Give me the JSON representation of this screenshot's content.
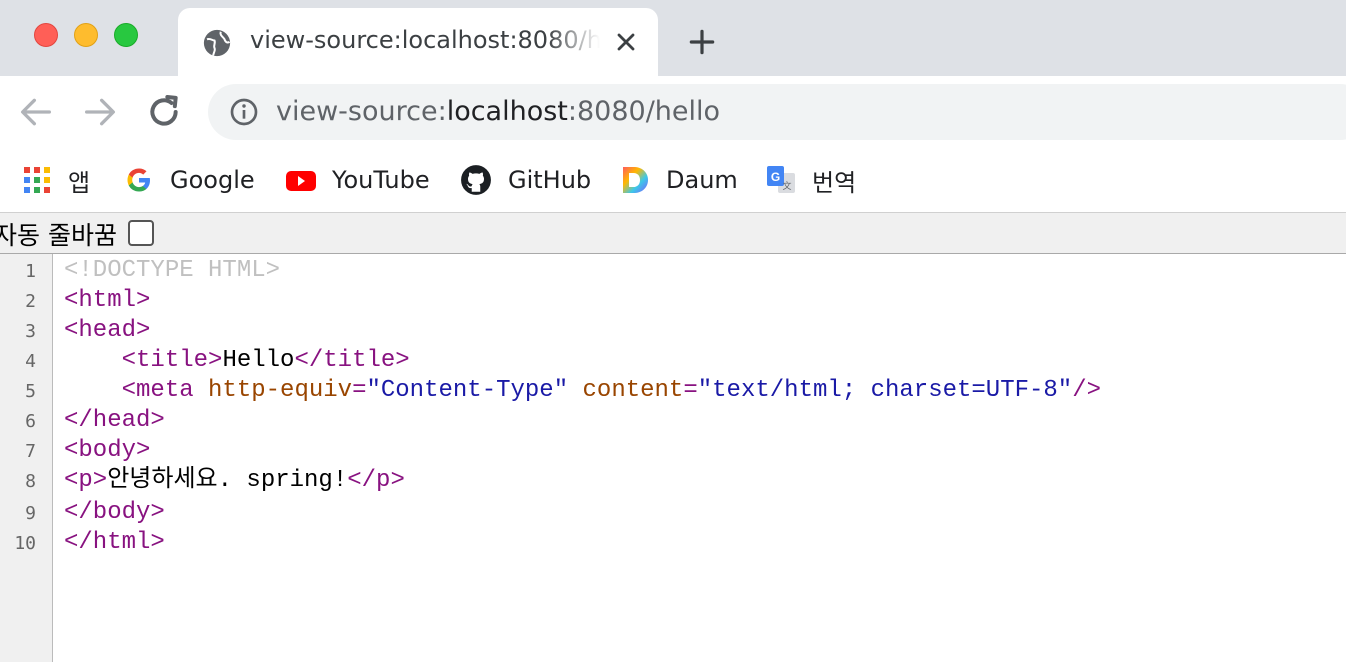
{
  "tab": {
    "title": "view-source:localhost:8080/hello",
    "icon": "globe-icon"
  },
  "omnibox": {
    "url_prefix": "view-source:",
    "url_host": "localhost",
    "url_rest": ":8080/hello"
  },
  "bookmarks": [
    {
      "label": "앱",
      "icon": "apps-grid-icon"
    },
    {
      "label": "Google",
      "icon": "google-icon"
    },
    {
      "label": "YouTube",
      "icon": "youtube-icon"
    },
    {
      "label": "GitHub",
      "icon": "github-icon"
    },
    {
      "label": "Daum",
      "icon": "daum-icon"
    },
    {
      "label": "번역",
      "icon": "translate-icon"
    }
  ],
  "wrap": {
    "label": "자동 줄바꿈"
  },
  "source": {
    "line_numbers": [
      "1",
      "2",
      "3",
      "4",
      "5",
      "6",
      "7",
      "8",
      "9",
      "10"
    ],
    "l1": "<!DOCTYPE HTML>",
    "l2": "<html>",
    "l3": "<head>",
    "l4_open": "<title>",
    "l4_text": "Hello",
    "l4_close": "</title>",
    "l5_open": "<meta",
    "l5_attr1": "http-equiv",
    "l5_eq1": "=",
    "l5_val1": "\"Content-Type\"",
    "l5_attr2": "content",
    "l5_eq2": "=",
    "l5_val2": "\"text/html; charset=UTF-8\"",
    "l5_end": "/>",
    "l6": "</head>",
    "l7": "<body>",
    "l8_open": "<p>",
    "l8_text": "안녕하세요. spring!",
    "l8_close": "</p>",
    "l9": "</body>",
    "l10": "</html>"
  },
  "colors": {
    "tag": "#881280",
    "attr": "#994500",
    "value": "#1a1aa6",
    "doctype": "#c0c0c0"
  }
}
